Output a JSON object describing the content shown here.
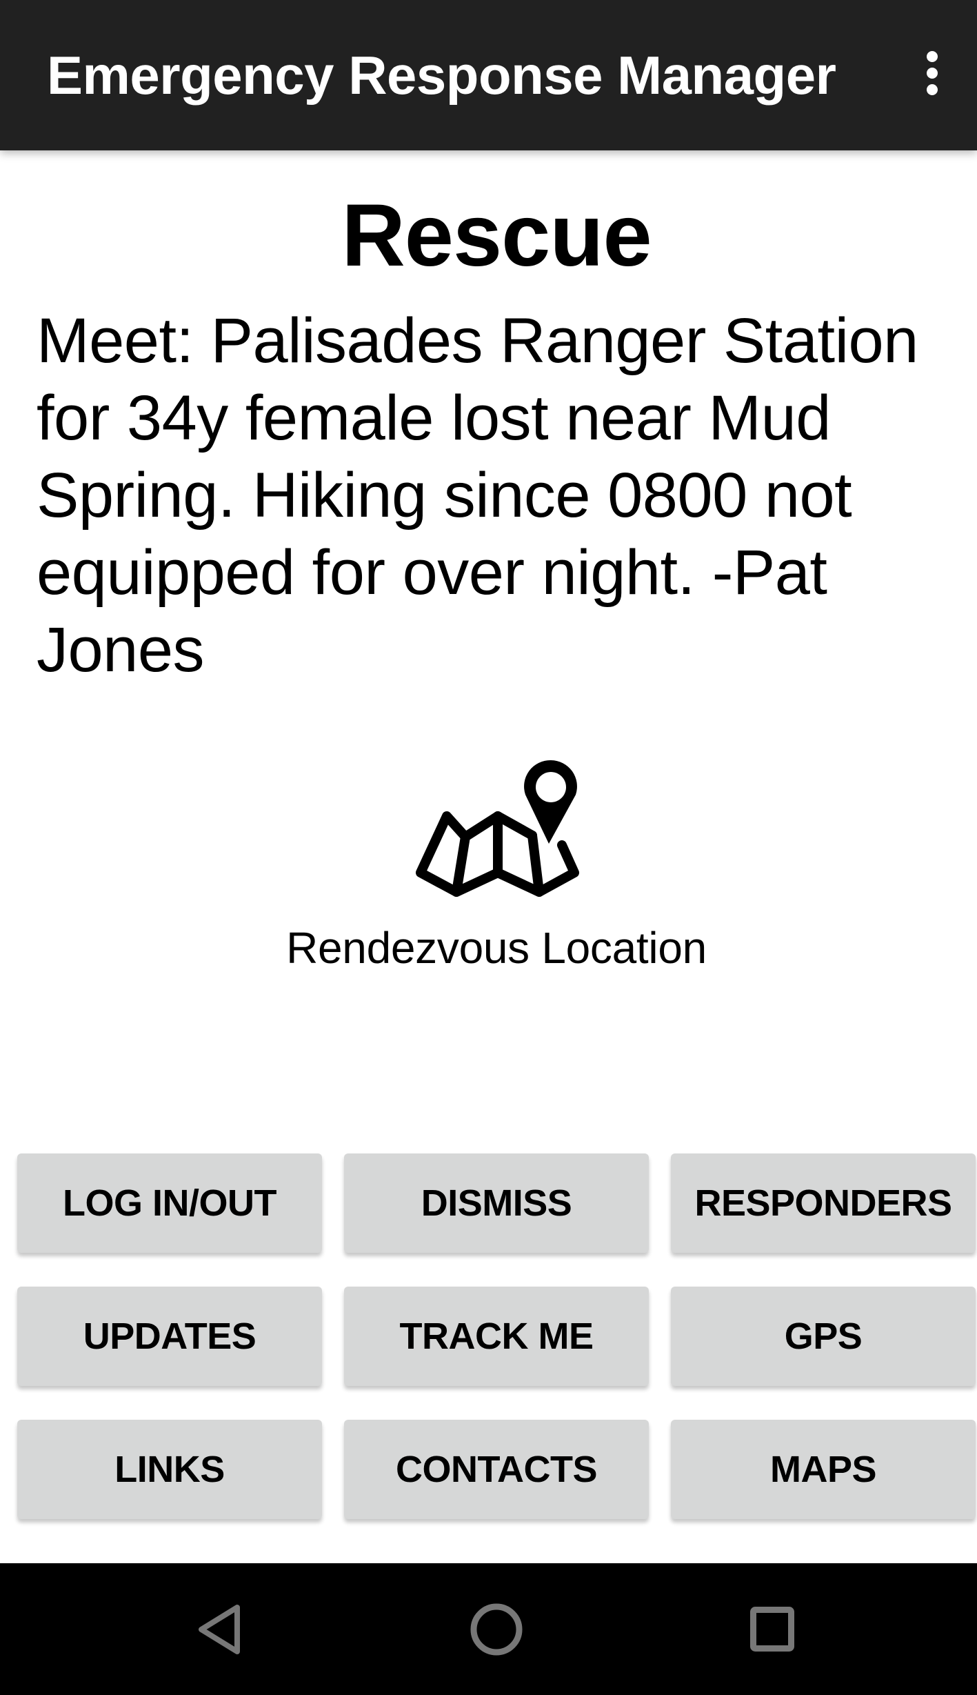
{
  "app_bar": {
    "title": "Emergency Response Manager",
    "overflow_icon": "more-vert-icon"
  },
  "alert": {
    "type": "Rescue",
    "message": "Meet: Palisades Ranger Station for 34y female lost near Mud Spring. Hiking since 0800 not equipped for over night. -Pat Jones"
  },
  "rendezvous": {
    "icon": "map-pin-icon",
    "label": "Rendezvous Location"
  },
  "buttons": [
    {
      "label": "LOG IN/OUT"
    },
    {
      "label": "DISMISS"
    },
    {
      "label": "RESPONDERS"
    },
    {
      "label": "UPDATES"
    },
    {
      "label": "TRACK ME"
    },
    {
      "label": "GPS"
    },
    {
      "label": "LINKS"
    },
    {
      "label": "CONTACTS"
    },
    {
      "label": "MAPS"
    }
  ],
  "nav_bar": {
    "back_icon": "back-triangle-icon",
    "home_icon": "home-circle-icon",
    "recents_icon": "recents-square-icon"
  },
  "colors": {
    "app_bar_bg": "#212121",
    "button_bg": "#d6d7d7",
    "nav_bar_bg": "#000000",
    "nav_icon": "#777777"
  }
}
